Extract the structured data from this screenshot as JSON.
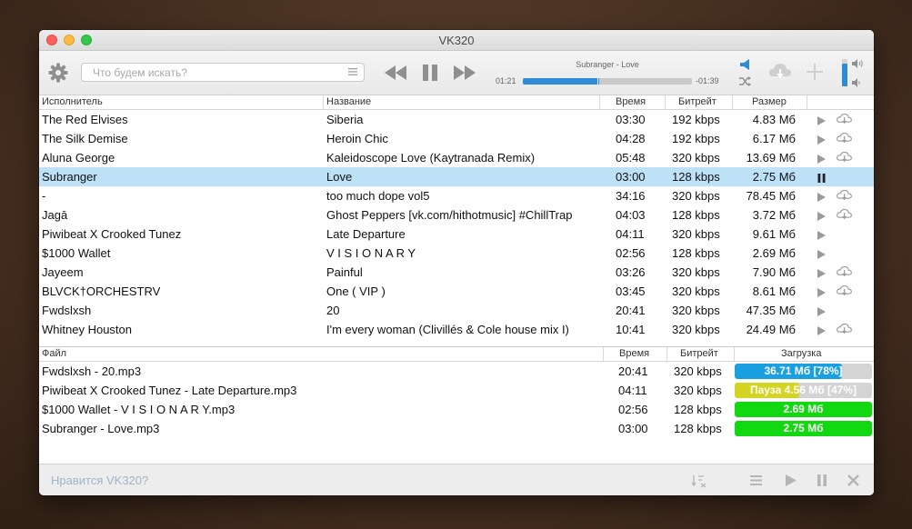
{
  "window": {
    "title": "VK320"
  },
  "toolbar": {
    "search_placeholder": "Что будем искать?",
    "now_playing": {
      "title": "Subranger - Love",
      "elapsed": "01:21",
      "remaining": "-01:39",
      "progress": 0.45
    },
    "volume_level": 0.85,
    "icons": [
      "gear-icon",
      "list-icon",
      "rewind-icon",
      "pause-icon",
      "fast-forward-icon",
      "broadcast-icon",
      "shuffle-icon",
      "cloud-download-icon",
      "plus-icon",
      "volume-up-icon",
      "volume-down-icon"
    ]
  },
  "tracks": {
    "headers": {
      "artist": "Исполнитель",
      "title": "Название",
      "time": "Время",
      "bitrate": "Битрейт",
      "size": "Размер"
    },
    "rows": [
      {
        "artist": "The Red Elvises",
        "title": "Siberia",
        "time": "03:30",
        "bitrate": "192 kbps",
        "size": "4.83 Мб",
        "cloud": true
      },
      {
        "artist": "The Silk Demise",
        "title": "Heroin Chic",
        "time": "04:28",
        "bitrate": "192 kbps",
        "size": "6.17 Мб",
        "cloud": true
      },
      {
        "artist": "Aluna George",
        "title": "Kaleidoscope Love (Kaytranada Remix)",
        "time": "05:48",
        "bitrate": "320 kbps",
        "size": "13.69 Мб",
        "cloud": true
      },
      {
        "artist": "Subranger",
        "title": "Love",
        "time": "03:00",
        "bitrate": "128 kbps",
        "size": "2.75 Мб",
        "selected": true,
        "playing": true
      },
      {
        "artist": "-",
        "title": "too much dope vol5",
        "time": "34:16",
        "bitrate": "320 kbps",
        "size": "78.45 Мб",
        "cloud": true
      },
      {
        "artist": "Jagā",
        "title": "Ghost Peppers [vk.com/hithotmusic] #ChillTrap",
        "time": "04:03",
        "bitrate": "128 kbps",
        "size": "3.72 Мб",
        "cloud": true
      },
      {
        "artist": "Piwibeat X Crooked Tunez",
        "title": "Late Departure",
        "time": "04:11",
        "bitrate": "320 kbps",
        "size": "9.61 Мб"
      },
      {
        "artist": "$1000 Wallet",
        "title": "V I S I O N A R Y",
        "time": "02:56",
        "bitrate": "128 kbps",
        "size": "2.69 Мб"
      },
      {
        "artist": "Jayeem",
        "title": "Painful",
        "time": "03:26",
        "bitrate": "320 kbps",
        "size": "7.90 Мб",
        "cloud": true
      },
      {
        "artist": "BLVCK†ORCHESTRV",
        "title": "One ( VIP )",
        "time": "03:45",
        "bitrate": "320 kbps",
        "size": "8.61 Мб",
        "cloud": true
      },
      {
        "artist": "Fwdslxsh",
        "title": "20",
        "time": "20:41",
        "bitrate": "320 kbps",
        "size": "47.35 Мб"
      },
      {
        "artist": "Whitney Houston",
        "title": "I'm every woman (Clivillés & Cole house mix I)",
        "time": "10:41",
        "bitrate": "320 kbps",
        "size": "24.49 Мб",
        "cloud": true
      }
    ]
  },
  "downloads": {
    "headers": {
      "file": "Файл",
      "time": "Время",
      "bitrate": "Битрейт",
      "progress": "Загрузка"
    },
    "rows": [
      {
        "file": "Fwdslxsh - 20.mp3",
        "time": "20:41",
        "bitrate": "320 kbps",
        "status": "36.71 Мб [78%]",
        "progress": 0.78,
        "color": "#1a9fe0"
      },
      {
        "file": "Piwibeat X Crooked Tunez - Late Departure.mp3",
        "time": "04:11",
        "bitrate": "320 kbps",
        "status": "Пауза 4.56 Мб [47%]",
        "progress": 0.47,
        "color": "#d4d422"
      },
      {
        "file": "$1000 Wallet - V I S I O N A R Y.mp3",
        "time": "02:56",
        "bitrate": "128 kbps",
        "status": "2.69 Мб",
        "progress": 1.0,
        "color": "#11d811"
      },
      {
        "file": "Subranger - Love.mp3",
        "time": "03:00",
        "bitrate": "128 kbps",
        "status": "2.75 Мб",
        "progress": 1.0,
        "color": "#11d811"
      }
    ]
  },
  "statusbar": {
    "rate_text": "Нравится VK320?",
    "icons": [
      "sort-icon",
      "list-icon",
      "play-icon",
      "pause-icon",
      "close-icon"
    ]
  },
  "colors": {
    "accent": "#2f8bd5",
    "selection": "#bde1f7",
    "icon_grey": "#8f8f8f"
  }
}
